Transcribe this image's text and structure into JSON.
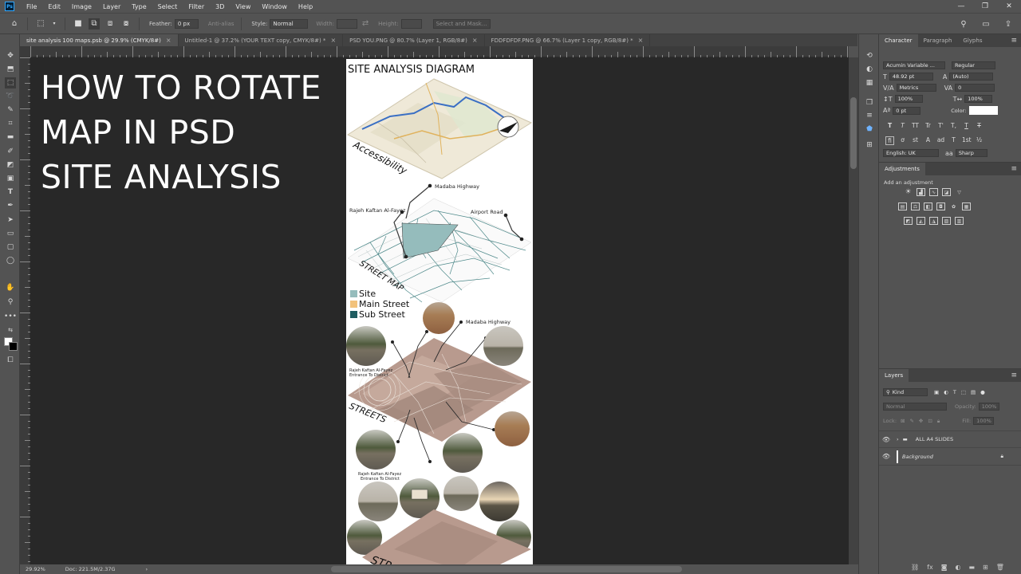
{
  "menubar": {
    "logo": "Ps",
    "items": [
      "File",
      "Edit",
      "Image",
      "Layer",
      "Type",
      "Select",
      "Filter",
      "3D",
      "View",
      "Window",
      "Help"
    ],
    "win": [
      "—",
      "❐",
      "✕"
    ]
  },
  "options": {
    "feather_label": "Feather:",
    "feather_value": "0 px",
    "antialias_label": "Anti-alias",
    "style_label": "Style:",
    "style_value": "Normal",
    "width_label": "Width:",
    "height_label": "Height:",
    "mask_button": "Select and Mask..."
  },
  "tabs": [
    {
      "label": "site analysis 100 maps.psb @ 29.9% (CMYK/8#)",
      "close": "×"
    },
    {
      "label": "Untitled-1 @ 37.2% (YOUR TEXT copy, CMYK/8#) *",
      "close": "×"
    },
    {
      "label": "PSD YOU.PNG @ 80.7% (Layer 1, RGB/8#)",
      "close": "×"
    },
    {
      "label": "FDDFDFDF.PNG @ 66.7% (Layer 1 copy, RGB/8#) *",
      "close": "×"
    }
  ],
  "canvas": {
    "headline_1": "HOW TO ROTATE",
    "headline_2": "MAP IN PSD",
    "headline_3": "SITE ANALYSIS",
    "doc_title": "SITE ANALYSIS DIAGRAM",
    "label_accessibility": "Accessibility",
    "label_madaba_1": "Madaba Highway",
    "label_rajeh": "Rajeh Kaftan Al-Fayez",
    "label_airport": "Airport Road",
    "label_street_map": "STREET MAP",
    "legend_site": "Site",
    "legend_main": "Main Street",
    "legend_sub": "Sub Street",
    "label_madaba_2": "Madaba Highway",
    "label_rajeh_entrance_1a": "Rajeh Kaftan Al-Fayez",
    "label_rajeh_entrance_1b": "Entrance To District",
    "label_streets": "STREETS",
    "label_rajeh_entrance_2a": "Rajeh Kaftan Al-Fayez",
    "label_rajeh_entrance_2b": "Entrance To District",
    "label_str": "STR"
  },
  "status": {
    "zoom": "29.92%",
    "doc": "Doc: 221.5M/2.37G",
    "arrow": "›"
  },
  "character": {
    "tabs": [
      "Character",
      "Paragraph",
      "Glyphs"
    ],
    "font_family": "Acumin Variable ...",
    "font_style": "Regular",
    "font_size": "48.92 pt",
    "leading": "(Auto)",
    "kerning": "Metrics",
    "tracking": "0",
    "v_scale": "100%",
    "h_scale": "100%",
    "baseline": "0 pt",
    "color_label": "Color:",
    "language": "English: UK",
    "antialias": "Sharp",
    "typo1": [
      "T",
      "T",
      "TT",
      "Tr",
      "T'",
      "T,",
      "T",
      "T"
    ],
    "typo2": [
      "fi",
      "ơ",
      "st",
      "A",
      "ad",
      "T",
      "1st",
      "½"
    ]
  },
  "adjustments": {
    "title": "Adjustments",
    "subtitle": "Add an adjustment"
  },
  "layers": {
    "title": "Layers",
    "filter_kind": "Kind",
    "blend_mode": "Normal",
    "opacity_label": "Opacity:",
    "opacity_value": "100%",
    "lock_label": "Lock:",
    "fill_label": "Fill:",
    "fill_value": "100%",
    "items": [
      {
        "name": "ALL A4 SLIDES",
        "type": "group"
      },
      {
        "name": "Background",
        "type": "layer",
        "locked": true
      }
    ]
  }
}
